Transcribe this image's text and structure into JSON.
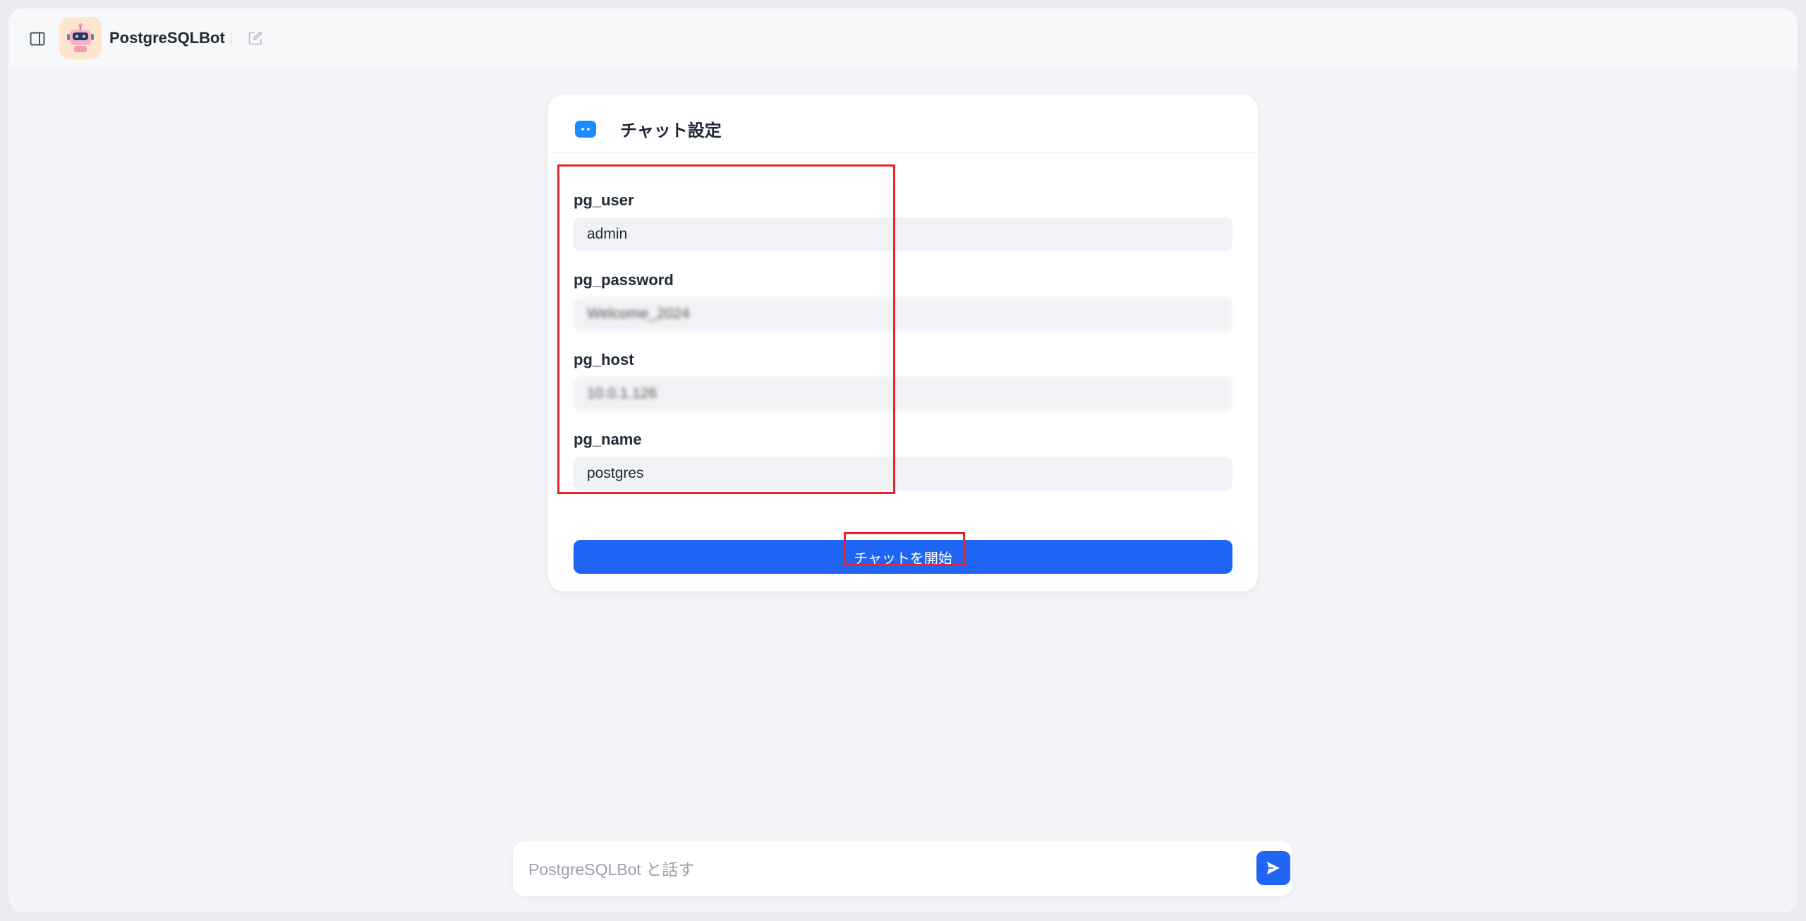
{
  "header": {
    "title": "PostgreSQLBot",
    "toggle_icon": "sidebar-toggle-icon",
    "new_chat_icon": "edit-icon"
  },
  "settings": {
    "title": "チャット設定",
    "fields": [
      {
        "label": "pg_user",
        "value": "admin"
      },
      {
        "label": "pg_password",
        "value": "Welcome_2024"
      },
      {
        "label": "pg_host",
        "value": "10.0.1.126"
      },
      {
        "label": "pg_name",
        "value": "postgres"
      }
    ],
    "start_label": "チャットを開始"
  },
  "chat": {
    "placeholder": "PostgreSQLBot と話す"
  },
  "colors": {
    "accent": "#1f64f2",
    "highlight": "#e5262b",
    "logo_bg": "#fde5cf"
  }
}
